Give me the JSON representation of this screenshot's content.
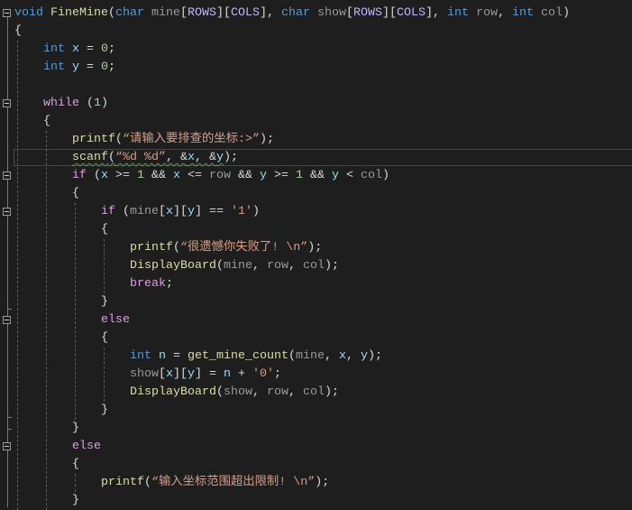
{
  "editor": {
    "theme_colors": {
      "background": "#1e1e1e",
      "keyword": "#569cd6",
      "function": "#dcdcaa",
      "macro": "#beb7ff",
      "parameter": "#9a9a9a",
      "local": "#9cdcfe",
      "number": "#b5cea8",
      "string": "#d69d85",
      "control": "#d8a0df"
    },
    "current_line": 9,
    "lines": [
      [
        [
          "void",
          "kw"
        ],
        [
          " ",
          "plain"
        ],
        [
          "FineMine",
          "fn"
        ],
        [
          "(",
          "plain"
        ],
        [
          "char",
          "kw"
        ],
        [
          " ",
          "plain"
        ],
        [
          "mine",
          "param"
        ],
        [
          "[",
          "plain"
        ],
        [
          "ROWS",
          "mac"
        ],
        [
          "][",
          "plain"
        ],
        [
          "COLS",
          "mac"
        ],
        [
          "], ",
          "plain"
        ],
        [
          "char",
          "kw"
        ],
        [
          " ",
          "plain"
        ],
        [
          "show",
          "param"
        ],
        [
          "[",
          "plain"
        ],
        [
          "ROWS",
          "mac"
        ],
        [
          "][",
          "plain"
        ],
        [
          "COLS",
          "mac"
        ],
        [
          "], ",
          "plain"
        ],
        [
          "int",
          "kw"
        ],
        [
          " ",
          "plain"
        ],
        [
          "row",
          "param"
        ],
        [
          ", ",
          "plain"
        ],
        [
          "int",
          "kw"
        ],
        [
          " ",
          "plain"
        ],
        [
          "col",
          "param"
        ],
        [
          ")",
          "plain"
        ]
      ],
      [
        [
          "{",
          "plain"
        ]
      ],
      [
        [
          "    ",
          "plain"
        ],
        [
          "int",
          "kw"
        ],
        [
          " ",
          "plain"
        ],
        [
          "x",
          "local"
        ],
        [
          " = ",
          "plain"
        ],
        [
          "0",
          "num"
        ],
        [
          ";",
          "plain"
        ]
      ],
      [
        [
          "    ",
          "plain"
        ],
        [
          "int",
          "kw"
        ],
        [
          " ",
          "plain"
        ],
        [
          "y",
          "local"
        ],
        [
          " = ",
          "plain"
        ],
        [
          "0",
          "num"
        ],
        [
          ";",
          "plain"
        ]
      ],
      [],
      [
        [
          "    ",
          "plain"
        ],
        [
          "while",
          "ctl"
        ],
        [
          " (",
          "plain"
        ],
        [
          "1",
          "num"
        ],
        [
          ")",
          "plain"
        ]
      ],
      [
        [
          "    {",
          "plain"
        ]
      ],
      [
        [
          "        ",
          "plain"
        ],
        [
          "printf",
          "fn"
        ],
        [
          "(",
          "plain"
        ],
        [
          "“请输入要排查的坐标:>”",
          "str"
        ],
        [
          ");",
          "plain"
        ]
      ],
      [
        [
          "        ",
          "plain"
        ],
        [
          "scanf",
          "fn"
        ],
        [
          "(",
          "plain"
        ],
        [
          "“%d %d”",
          "str"
        ],
        [
          ", &",
          "plain"
        ],
        [
          "x",
          "local"
        ],
        [
          ", &",
          "plain"
        ],
        [
          "y",
          "local"
        ],
        [
          ");",
          "plain"
        ]
      ],
      [
        [
          "        ",
          "plain"
        ],
        [
          "if",
          "ctl"
        ],
        [
          " (",
          "plain"
        ],
        [
          "x",
          "local"
        ],
        [
          " >= ",
          "plain"
        ],
        [
          "1",
          "num"
        ],
        [
          " && ",
          "plain"
        ],
        [
          "x",
          "local"
        ],
        [
          " <= ",
          "plain"
        ],
        [
          "row",
          "param"
        ],
        [
          " && ",
          "plain"
        ],
        [
          "y",
          "local"
        ],
        [
          " >= ",
          "plain"
        ],
        [
          "1",
          "num"
        ],
        [
          " && ",
          "plain"
        ],
        [
          "y",
          "local"
        ],
        [
          " < ",
          "plain"
        ],
        [
          "col",
          "param"
        ],
        [
          ")",
          "plain"
        ]
      ],
      [
        [
          "        {",
          "plain"
        ]
      ],
      [
        [
          "            ",
          "plain"
        ],
        [
          "if",
          "ctl"
        ],
        [
          " (",
          "plain"
        ],
        [
          "mine",
          "param"
        ],
        [
          "[",
          "plain"
        ],
        [
          "x",
          "local"
        ],
        [
          "][",
          "plain"
        ],
        [
          "y",
          "local"
        ],
        [
          "] == ",
          "plain"
        ],
        [
          "'1'",
          "str"
        ],
        [
          ")",
          "plain"
        ]
      ],
      [
        [
          "            {",
          "plain"
        ]
      ],
      [
        [
          "                ",
          "plain"
        ],
        [
          "printf",
          "fn"
        ],
        [
          "(",
          "plain"
        ],
        [
          "“很遗憾你失败了! \\n”",
          "str"
        ],
        [
          ");",
          "plain"
        ]
      ],
      [
        [
          "                ",
          "plain"
        ],
        [
          "DisplayBoard",
          "fn"
        ],
        [
          "(",
          "plain"
        ],
        [
          "mine",
          "param"
        ],
        [
          ", ",
          "plain"
        ],
        [
          "row",
          "param"
        ],
        [
          ", ",
          "plain"
        ],
        [
          "col",
          "param"
        ],
        [
          ");",
          "plain"
        ]
      ],
      [
        [
          "                ",
          "plain"
        ],
        [
          "break",
          "ctl"
        ],
        [
          ";",
          "plain"
        ]
      ],
      [
        [
          "            }",
          "plain"
        ]
      ],
      [
        [
          "            ",
          "plain"
        ],
        [
          "else",
          "ctl"
        ]
      ],
      [
        [
          "            {",
          "plain"
        ]
      ],
      [
        [
          "                ",
          "plain"
        ],
        [
          "int",
          "kw"
        ],
        [
          " ",
          "plain"
        ],
        [
          "n",
          "local"
        ],
        [
          " = ",
          "plain"
        ],
        [
          "get_mine_count",
          "fn"
        ],
        [
          "(",
          "plain"
        ],
        [
          "mine",
          "param"
        ],
        [
          ", ",
          "plain"
        ],
        [
          "x",
          "local"
        ],
        [
          ", ",
          "plain"
        ],
        [
          "y",
          "local"
        ],
        [
          ");",
          "plain"
        ]
      ],
      [
        [
          "                ",
          "plain"
        ],
        [
          "show",
          "param"
        ],
        [
          "[",
          "plain"
        ],
        [
          "x",
          "local"
        ],
        [
          "][",
          "plain"
        ],
        [
          "y",
          "local"
        ],
        [
          "] = ",
          "plain"
        ],
        [
          "n",
          "local"
        ],
        [
          " + ",
          "plain"
        ],
        [
          "'0'",
          "str"
        ],
        [
          ";",
          "plain"
        ]
      ],
      [
        [
          "                ",
          "plain"
        ],
        [
          "DisplayBoard",
          "fn"
        ],
        [
          "(",
          "plain"
        ],
        [
          "show",
          "param"
        ],
        [
          ", ",
          "plain"
        ],
        [
          "row",
          "param"
        ],
        [
          ", ",
          "plain"
        ],
        [
          "col",
          "param"
        ],
        [
          ");",
          "plain"
        ]
      ],
      [
        [
          "            }",
          "plain"
        ]
      ],
      [
        [
          "        }",
          "plain"
        ]
      ],
      [
        [
          "        ",
          "plain"
        ],
        [
          "else",
          "ctl"
        ]
      ],
      [
        [
          "        {",
          "plain"
        ]
      ],
      [
        [
          "            ",
          "plain"
        ],
        [
          "printf",
          "fn"
        ],
        [
          "(",
          "plain"
        ],
        [
          "“输入坐标范围超出限制! \\n”",
          "str"
        ],
        [
          ");",
          "plain"
        ]
      ],
      [
        [
          "        }",
          "plain"
        ]
      ]
    ]
  }
}
